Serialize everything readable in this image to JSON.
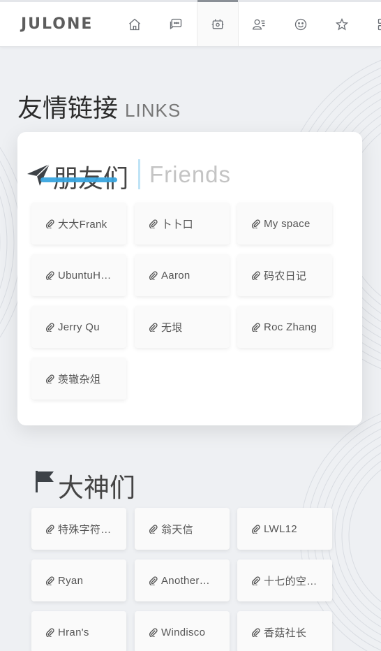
{
  "brand": {
    "logo_text": "JULONE"
  },
  "nav": {
    "items": [
      {
        "icon": "home-icon",
        "active": false
      },
      {
        "icon": "chat-bubble-icon",
        "active": false
      },
      {
        "icon": "links-frame-icon",
        "active": true
      },
      {
        "icon": "user-profile-icon",
        "active": false
      },
      {
        "icon": "smiley-icon",
        "active": false
      },
      {
        "icon": "star-outline-icon",
        "active": false
      },
      {
        "icon": "grid-icon",
        "active": false
      }
    ]
  },
  "page": {
    "title_cn": "友情链接",
    "title_en": "LINKS"
  },
  "friends": {
    "heading_cn": "朋友们",
    "heading_en": "Friends",
    "links": [
      {
        "label": "大大Frank"
      },
      {
        "label": "卜卜口"
      },
      {
        "label": "My space"
      },
      {
        "label": "UbuntuH…"
      },
      {
        "label": "Aaron"
      },
      {
        "label": "码农日记"
      },
      {
        "label": "Jerry Qu"
      },
      {
        "label": "无垠"
      },
      {
        "label": "Roc Zhang"
      },
      {
        "label": "羡辙杂俎"
      }
    ]
  },
  "gods": {
    "heading_cn": "大神们",
    "links": [
      {
        "label": "特殊字符…"
      },
      {
        "label": "翁天信"
      },
      {
        "label": "LWL12"
      },
      {
        "label": "Ryan"
      },
      {
        "label": "Another…"
      },
      {
        "label": "十七的空…"
      },
      {
        "label": "Hran's"
      },
      {
        "label": "Windisco"
      },
      {
        "label": "香菇社长"
      }
    ]
  },
  "colors": {
    "accent": "#3aa5df",
    "accent_light": "#bfe3f6",
    "page_bg": "#eef0f3"
  }
}
